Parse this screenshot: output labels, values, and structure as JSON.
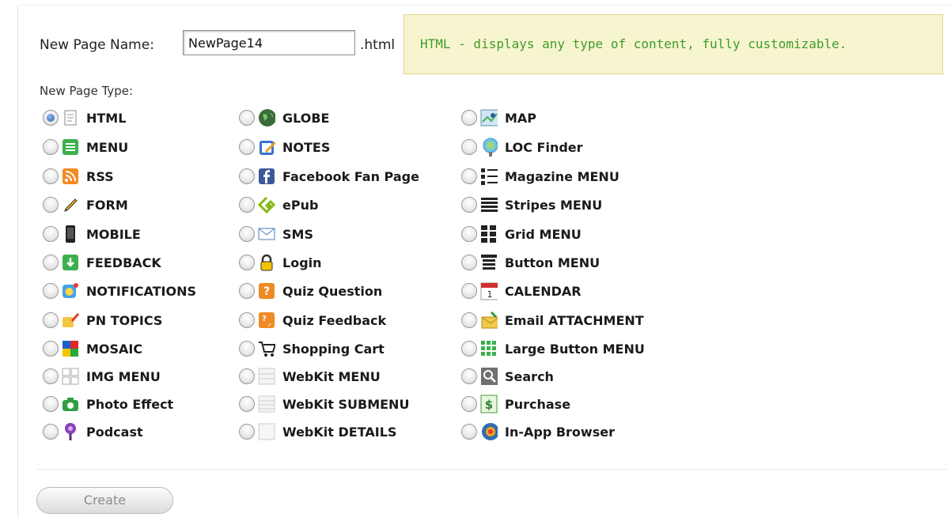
{
  "form": {
    "name_label": "New Page Name:",
    "name_value": "NewPage14",
    "extension": ".html",
    "description": "HTML - displays any type of content, fully customizable.",
    "type_label": "New Page Type:",
    "create_label": "Create"
  },
  "columns": [
    {
      "items": [
        {
          "label": "HTML",
          "icon": "html-icon",
          "selected": true
        },
        {
          "label": "MENU",
          "icon": "menu-icon"
        },
        {
          "label": "RSS",
          "icon": "rss-icon"
        },
        {
          "label": "FORM",
          "icon": "form-icon"
        },
        {
          "label": "MOBILE",
          "icon": "mobile-icon"
        },
        {
          "label": "FEEDBACK",
          "icon": "feedback-icon"
        },
        {
          "label": "NOTIFICATIONS",
          "icon": "notifications-icon"
        },
        {
          "label": "PN TOPICS",
          "icon": "pn-topics-icon"
        },
        {
          "label": "MOSAIC",
          "icon": "mosaic-icon"
        },
        {
          "label": "IMG MENU",
          "icon": "img-menu-icon"
        },
        {
          "label": "Photo Effect",
          "icon": "camera-icon"
        },
        {
          "label": "Podcast",
          "icon": "podcast-icon"
        }
      ]
    },
    {
      "items": [
        {
          "label": "GLOBE",
          "icon": "globe-icon"
        },
        {
          "label": "NOTES",
          "icon": "notes-icon"
        },
        {
          "label": "Facebook Fan Page",
          "icon": "facebook-icon"
        },
        {
          "label": "ePub",
          "icon": "epub-icon"
        },
        {
          "label": "SMS",
          "icon": "sms-icon"
        },
        {
          "label": "Login",
          "icon": "lock-icon"
        },
        {
          "label": "Quiz Question",
          "icon": "quiz-question-icon"
        },
        {
          "label": "Quiz Feedback",
          "icon": "quiz-feedback-icon"
        },
        {
          "label": "Shopping Cart",
          "icon": "cart-icon"
        },
        {
          "label": "WebKit MENU",
          "icon": "webkit-menu-icon"
        },
        {
          "label": "WebKit SUBMENU",
          "icon": "webkit-submenu-icon"
        },
        {
          "label": "WebKit DETAILS",
          "icon": "webkit-details-icon"
        }
      ]
    },
    {
      "items": [
        {
          "label": "MAP",
          "icon": "map-icon"
        },
        {
          "label": "LOC Finder",
          "icon": "loc-finder-icon"
        },
        {
          "label": "Magazine MENU",
          "icon": "magazine-menu-icon"
        },
        {
          "label": "Stripes MENU",
          "icon": "stripes-menu-icon"
        },
        {
          "label": "Grid MENU",
          "icon": "grid-menu-icon"
        },
        {
          "label": "Button MENU",
          "icon": "button-menu-icon"
        },
        {
          "label": "CALENDAR",
          "icon": "calendar-icon"
        },
        {
          "label": "Email ATTACHMENT",
          "icon": "email-attachment-icon"
        },
        {
          "label": "Large Button MENU",
          "icon": "large-button-menu-icon"
        },
        {
          "label": "Search",
          "icon": "search-icon"
        },
        {
          "label": "Purchase",
          "icon": "purchase-icon"
        },
        {
          "label": "In-App Browser",
          "icon": "browser-icon"
        }
      ]
    }
  ]
}
